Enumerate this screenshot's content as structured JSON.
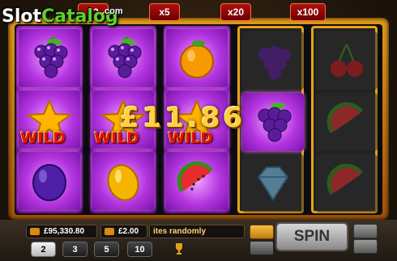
{
  "logo": {
    "slot": "Slot",
    "catalog": "Catalog",
    "com": ".com"
  },
  "multipliers": [
    "x2",
    "x5",
    "x20",
    "x100"
  ],
  "reels": [
    [
      "grapes",
      "wild",
      "plum"
    ],
    [
      "grapes",
      "wild",
      "lemon"
    ],
    [
      "orange",
      "wild",
      "watermelon"
    ],
    [
      "grapes",
      "grapes",
      "diamond"
    ],
    [
      "cherries",
      "watermelon",
      "watermelon"
    ]
  ],
  "wild_label": "WILD",
  "win_amount": "£11.86",
  "colors": {
    "lit_reel": "#7b1fa8",
    "frame": "#e8a315",
    "win_text": "#ffd040",
    "wild_text": "#e71212"
  },
  "bottom_bar": {
    "balance": "£95,330.80",
    "bet": "£2.00",
    "message": "ites randomly",
    "stakes": [
      "2",
      "3",
      "5",
      "10"
    ],
    "selected_stake": "2",
    "spin_label": "SPIN"
  }
}
